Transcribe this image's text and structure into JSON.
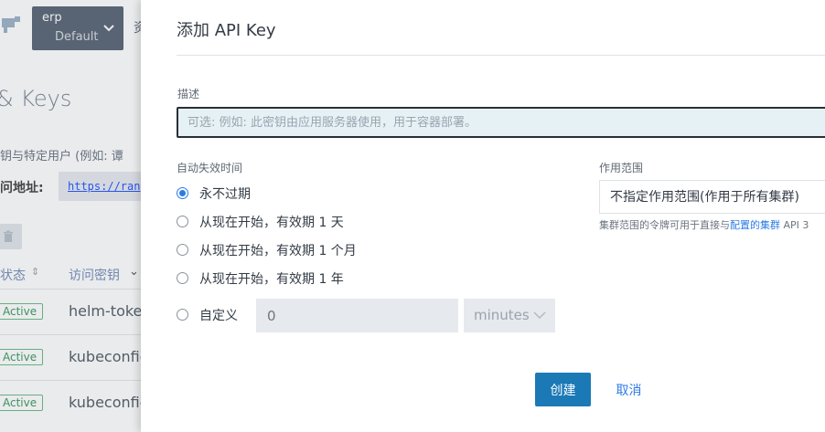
{
  "background": {
    "cluster_switcher": {
      "name": "erp",
      "project": "Default"
    },
    "nav_partial": "资",
    "page_title": "& Keys",
    "description_partial": "钥与特定用户 (例如: 谭",
    "endpoint_label": "问地址:",
    "endpoint_value": "https://ran",
    "table": {
      "headers": {
        "state": "状态",
        "access_key": "访问密钥"
      },
      "rows": [
        {
          "state": "Active",
          "name": "helm-token"
        },
        {
          "state": "Active",
          "name": "kubeconfig"
        },
        {
          "state": "Active",
          "name": "kubeconfig"
        }
      ]
    }
  },
  "modal": {
    "title": "添加 API Key",
    "description_label": "描述",
    "description_placeholder": "可选: 例如: 此密钥由应用服务器使用，用于容器部署。",
    "expiry_label": "自动失效时间",
    "expiry_options": [
      {
        "label": "永不过期",
        "checked": true
      },
      {
        "label": "从现在开始，有效期 1 天",
        "checked": false
      },
      {
        "label": "从现在开始，有效期 1 个月",
        "checked": false
      },
      {
        "label": "从现在开始，有效期 1 年",
        "checked": false
      },
      {
        "label": "自定义",
        "checked": false
      }
    ],
    "custom_separator": "-",
    "custom_value_placeholder": "0",
    "custom_unit": "minutes",
    "scope_label": "作用范围",
    "scope_value": "不指定作用范围(作用于所有集群)",
    "scope_help_prefix": "集群范围的令牌可用于直接与",
    "scope_help_link": "配置的集群",
    "scope_help_suffix": " API 3",
    "create_button": "创建",
    "cancel_button": "取消"
  }
}
